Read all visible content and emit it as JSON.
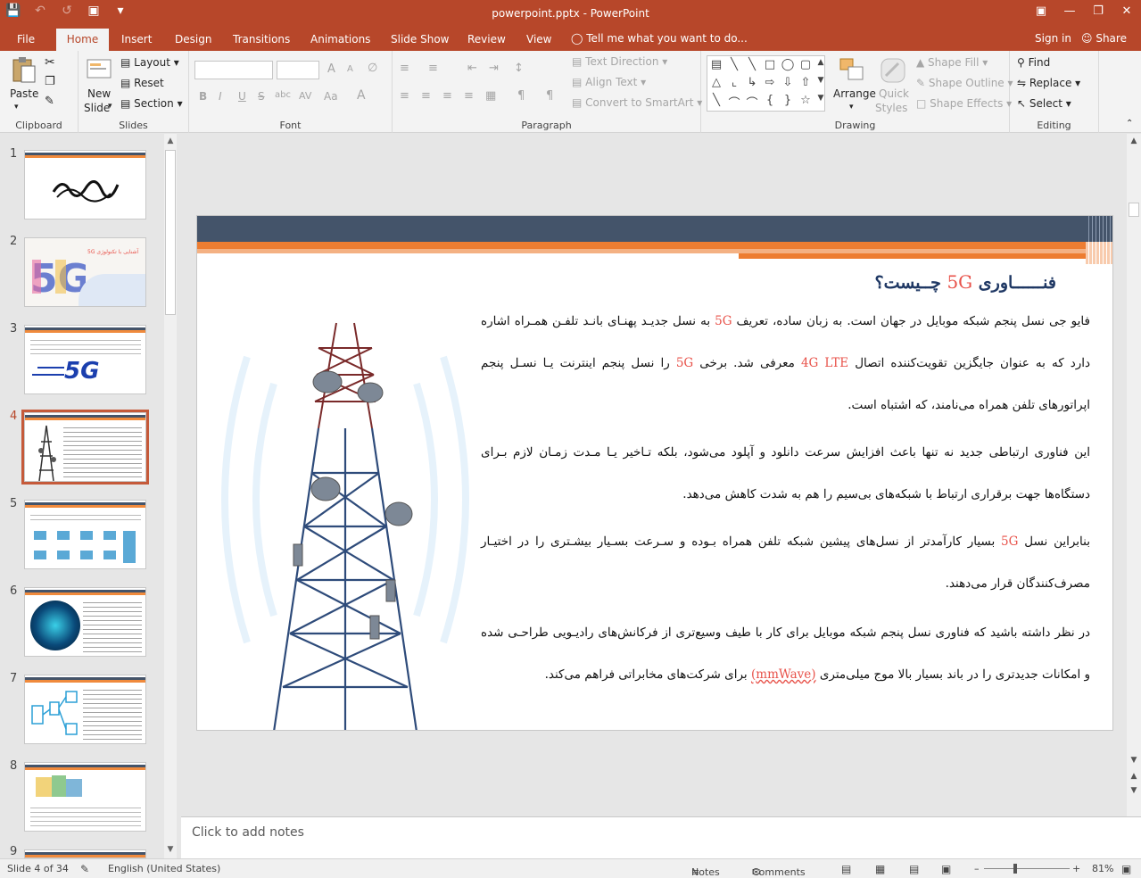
{
  "app": {
    "doc_title": "powerpoint.pptx - PowerPoint",
    "accent": "#b7472a"
  },
  "tabs": [
    "File",
    "Home",
    "Insert",
    "Design",
    "Transitions",
    "Animations",
    "Slide Show",
    "Review",
    "View"
  ],
  "active_tab": "Home",
  "tell_me": "Tell me what you want to do...",
  "sign_in": "Sign in",
  "share": "Share",
  "ribbon": {
    "clipboard": {
      "label": "Clipboard",
      "paste": "Paste"
    },
    "slides": {
      "label": "Slides",
      "new_slide": "New",
      "new_slide2": "Slide",
      "layout": "Layout",
      "reset": "Reset",
      "section": "Section"
    },
    "font": {
      "label": "Font",
      "bold": "B",
      "italic": "I",
      "underline": "U",
      "strike": "S",
      "abc": "abc",
      "av": "AV",
      "aa": "Aa",
      "grow": "A",
      "shrink": "A"
    },
    "paragraph": {
      "label": "Paragraph",
      "text_direction": "Text Direction",
      "align_text": "Align Text",
      "convert": "Convert to SmartArt"
    },
    "drawing": {
      "label": "Drawing",
      "arrange": "Arrange",
      "quick_styles": "Quick",
      "quick_styles2": "Styles",
      "shape_fill": "Shape Fill",
      "shape_outline": "Shape Outline",
      "shape_effects": "Shape Effects"
    },
    "editing": {
      "label": "Editing",
      "find": "Find",
      "replace": "Replace",
      "select": "Select"
    }
  },
  "thumbnails": [
    {
      "num": "1"
    },
    {
      "num": "2",
      "caption": "آشنایی با تکنولوژی 5G"
    },
    {
      "num": "3",
      "caption": "5G"
    },
    {
      "num": "4"
    },
    {
      "num": "5"
    },
    {
      "num": "6"
    },
    {
      "num": "7"
    },
    {
      "num": "8"
    },
    {
      "num": "9"
    }
  ],
  "active_slide": "4",
  "slide": {
    "title_pre": "فنــــــاوری ",
    "title_5g": "5G",
    "title_post": " چــیست؟",
    "p1_a": "فایو جی نسل پنجم شبکه موبایل در جهان است. به زبان ساده، تعریف ",
    "p1_5g": "5G",
    "p1_b": "  به نسل جدیـد پهنـای بانـد تلفـن همـراه اشاره دارد که به عنوان جایگزین تقویت‌کننده اتصال ",
    "p1_4g": "4G LTE",
    "p1_c": " معرفی شد. برخی  ",
    "p1_5g2": "5G",
    "p1_d": "  را نسل پنجم اینترنت یـا نسـل پنجم اپراتورهای تلفن همراه می‌نامند، که اشتباه است.",
    "p2": "این فناوری ارتباطی جدید نه تنها باعث افزایش سرعت دانلود و آپلود می‌شود، بلکه تـاخیر یـا مـدت زمـان لازم بـرای دستگاه‌ها جهت برقراری ارتباط با شبکه‌های بی‌سیم را هم به شدت کاهش می‌دهد.",
    "p3_a": "بنابراین نسل ",
    "p3_5g": "5G",
    "p3_b": " بسیار کارآمدتر از نسل‌های پیشین شبکه تلفن همراه بـوده و سـرعت بسـیار بیشـتری را در اختیـار مصرف‌کنندگان قرار می‌دهند.",
    "p4_a": "در نظر داشته باشید که فناوری نسل پنجم شبکه موبایل برای کار با طیف وسیع‌تری از فرکانش‌های رادیـویی طراحـی شده و امکانات جدیدتری را در باند بسیار بالا موج میلی‌متری ",
    "p4_mm": "(mmWave)",
    "p4_b": " برای شرکت‌های مخابراتی فراهم می‌کند."
  },
  "notes_placeholder": "Click to add notes",
  "status": {
    "slide_of": "Slide 4 of 34",
    "language": "English (United States)",
    "notes": "Notes",
    "comments": "Comments",
    "zoom": "81%"
  }
}
